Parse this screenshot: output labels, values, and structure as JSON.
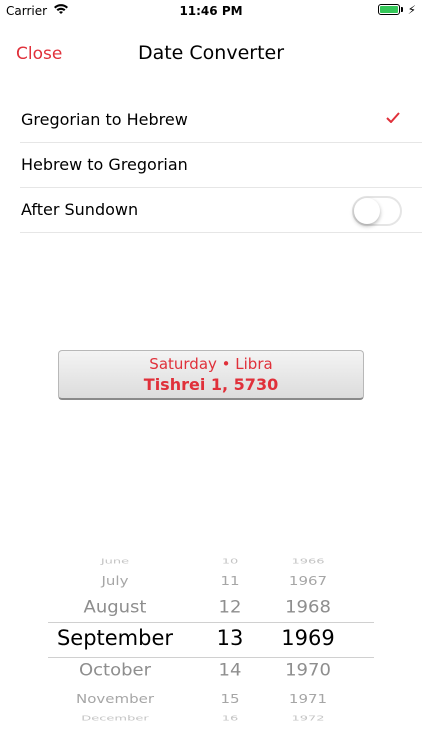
{
  "status_bar": {
    "carrier": "Carrier",
    "time": "11:46 PM"
  },
  "nav": {
    "close_label": "Close",
    "title": "Date Converter"
  },
  "options": [
    {
      "label": "Gregorian to Hebrew",
      "selected": true
    },
    {
      "label": "Hebrew to Gregorian",
      "selected": false
    },
    {
      "label": "After Sundown",
      "toggle": false
    }
  ],
  "result": {
    "subtitle": "Saturday • Libra",
    "date": "Tishrei 1, 5730"
  },
  "picker": {
    "months": [
      "June",
      "July",
      "August",
      "September",
      "October",
      "November",
      "December"
    ],
    "days": [
      "10",
      "11",
      "12",
      "13",
      "14",
      "15",
      "16"
    ],
    "years": [
      "1966",
      "1967",
      "1968",
      "1969",
      "1970",
      "1971",
      "1972"
    ],
    "selected": {
      "month": "September",
      "day": "13",
      "year": "1969"
    }
  },
  "colors": {
    "accent": "#e0303a",
    "battery": "#34c759"
  }
}
